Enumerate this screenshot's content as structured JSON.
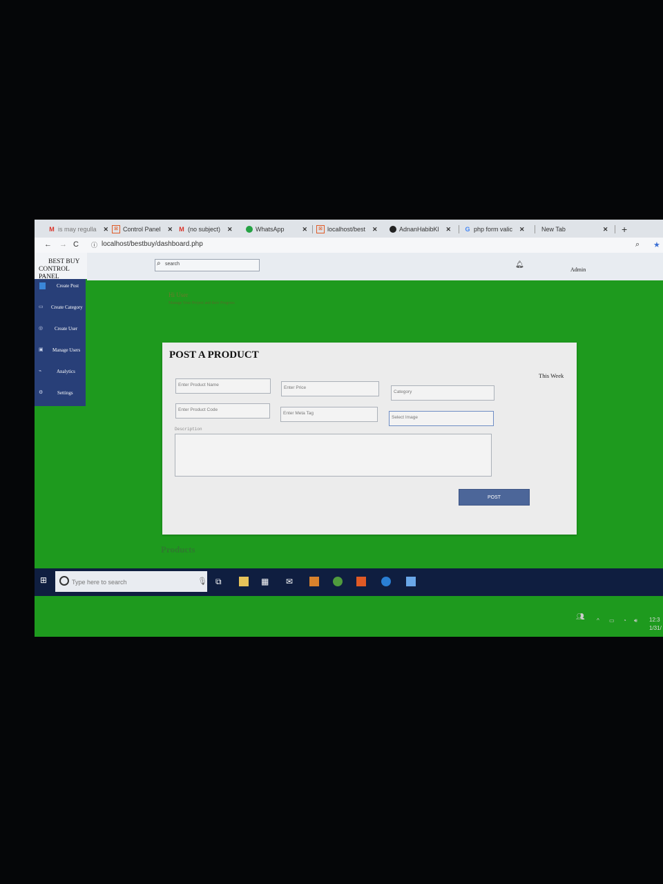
{
  "browser": {
    "tabs": [
      {
        "label": "is may regulla",
        "icon": "gmail-icon"
      },
      {
        "label": "Control Panel",
        "icon": "xampp-icon"
      },
      {
        "label": "(no subject)",
        "icon": "gmail-icon"
      },
      {
        "label": "WhatsApp",
        "icon": "whatsapp-icon"
      },
      {
        "label": "localhost/best",
        "icon": "xampp-icon"
      },
      {
        "label": "AdnanHabibKl",
        "icon": "github-icon"
      },
      {
        "label": "php form valic",
        "icon": "google-icon"
      },
      {
        "label": "New Tab",
        "icon": ""
      }
    ],
    "url": "localhost/bestbuy/dashboard.php"
  },
  "brand": {
    "line1": "BEST BUY",
    "line2": "CONTROL PANEL"
  },
  "sidebar": {
    "items": [
      {
        "label": "Create Post",
        "icon": "post-icon"
      },
      {
        "label": "Create Category",
        "icon": "category-icon"
      },
      {
        "label": "Create User",
        "icon": "user-icon"
      },
      {
        "label": "Manage Users",
        "icon": "manage-icon"
      },
      {
        "label": "Analytics",
        "icon": "chart-icon"
      },
      {
        "label": "Settings",
        "icon": "gear-icon"
      }
    ]
  },
  "topbar": {
    "search_placeholder": "search",
    "user": "Admin"
  },
  "greeting": {
    "title": "Hi User",
    "subtitle": "Manage Your Project and their Progress"
  },
  "form": {
    "title": "POST A PRODUCT",
    "period": "This Week",
    "product_name_placeholder": "Enter Product Name",
    "price_placeholder": "Enter Price",
    "category_placeholder": "Category",
    "product_code_placeholder": "Enter Product Code",
    "meta_tag_placeholder": "Enter Meta Tag",
    "image_placeholder": "Select Image",
    "description_label": "Description",
    "post_label": "POST"
  },
  "products_heading": "Products",
  "taskbar": {
    "search_placeholder": "Type here to search",
    "time": "12:3",
    "date": "1/31/"
  }
}
